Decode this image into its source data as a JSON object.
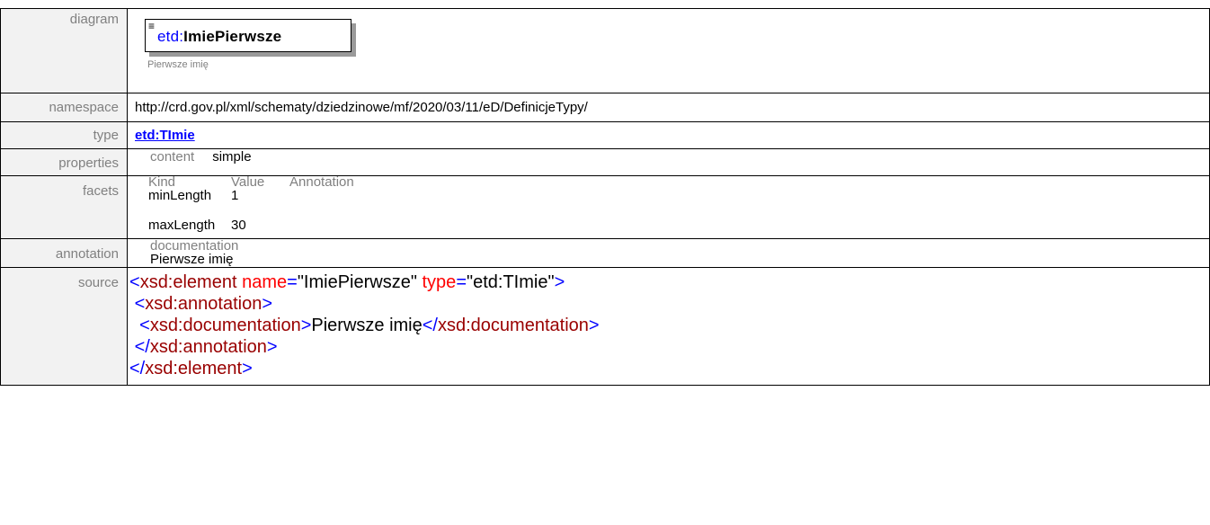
{
  "labels": {
    "diagram": "diagram",
    "namespace": "namespace",
    "type": "type",
    "properties": "properties",
    "facets": "facets",
    "annotation": "annotation",
    "source": "source"
  },
  "diagram": {
    "element_prefix": "etd:",
    "element_name": "ImiePierwsze",
    "caption": "Pierwsze imię"
  },
  "namespace": {
    "value": "http://crd.gov.pl/xml/schematy/dziedzinowe/mf/2020/03/11/eD/DefinicjeTypy/"
  },
  "type": {
    "value": "etd:TImie"
  },
  "properties": {
    "header": "content",
    "value": "simple"
  },
  "facets": {
    "columns": [
      "Kind",
      "Value",
      "Annotation"
    ],
    "rows": [
      {
        "kind": "minLength",
        "value": "1",
        "annotation": ""
      },
      {
        "kind": "maxLength",
        "value": "30",
        "annotation": ""
      }
    ]
  },
  "annotation": {
    "header": "documentation",
    "text": "Pierwsze imię"
  },
  "source": {
    "line1": {
      "open": "<",
      "tag": "xsd:element",
      "attr1": "name",
      "eq1": "=",
      "val1": "\"ImiePierwsze\"",
      "attr2": "type",
      "eq2": "=",
      "val2": "\"etd:TImie\"",
      "close": ">"
    },
    "line2": {
      "open": "<",
      "tag": "xsd:annotation",
      "close": ">"
    },
    "line3": {
      "open": "<",
      "tag": "xsd:documentation",
      "close": ">",
      "text": "Pierwsze imię",
      "endopen": "</",
      "endtag": "xsd:documentation",
      "endclose": ">"
    },
    "line4": {
      "open": "</",
      "tag": "xsd:annotation",
      "close": ">"
    },
    "line5": {
      "open": "</",
      "tag": "xsd:element",
      "close": ">"
    }
  },
  "colors": {
    "label_bg": "#f2f2f2",
    "label_text": "#808080",
    "link": "#0000ff",
    "xml_bracket": "#0000ff",
    "xml_tag": "#990000",
    "xml_attr": "#ff0000"
  }
}
